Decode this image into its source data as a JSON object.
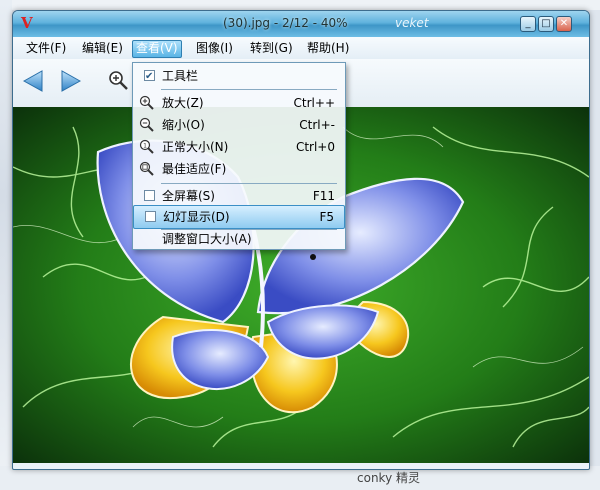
{
  "window": {
    "title": "(30).jpg - 2/12 - 40%",
    "brand": "veket",
    "controls": {
      "minimize": "_",
      "maximize": "□",
      "close": "✕"
    }
  },
  "menubar": {
    "items": [
      {
        "label": "文件(F)"
      },
      {
        "label": "编辑(E)"
      },
      {
        "label": "查看(V)"
      },
      {
        "label": "图像(I)"
      },
      {
        "label": "转到(G)"
      },
      {
        "label": "帮助(H)"
      }
    ]
  },
  "view_menu": {
    "items": [
      {
        "label": "工具栏",
        "type": "check",
        "checked": true
      },
      {
        "label": "放大(Z)",
        "shortcut": "Ctrl++",
        "icon": "zoom-in-icon"
      },
      {
        "label": "缩小(O)",
        "shortcut": "Ctrl+-",
        "icon": "zoom-out-icon"
      },
      {
        "label": "正常大小(N)",
        "shortcut": "Ctrl+0",
        "icon": "zoom-normal-icon"
      },
      {
        "label": "最佳适应(F)",
        "icon": "zoom-fit-icon"
      },
      {
        "label": "全屏幕(S)",
        "shortcut": "F11",
        "type": "check",
        "checked": false
      },
      {
        "label": "幻灯显示(D)",
        "shortcut": "F5",
        "type": "check",
        "checked": false,
        "highlighted": true
      },
      {
        "label": "调整窗口大小(A)"
      }
    ]
  },
  "desktop": {
    "bottom_label": "conky 精灵"
  },
  "colors": {
    "titlebar": "#3e96c7",
    "highlight": "#8fcbf0",
    "nav_arrow": "#3f8fd0"
  }
}
